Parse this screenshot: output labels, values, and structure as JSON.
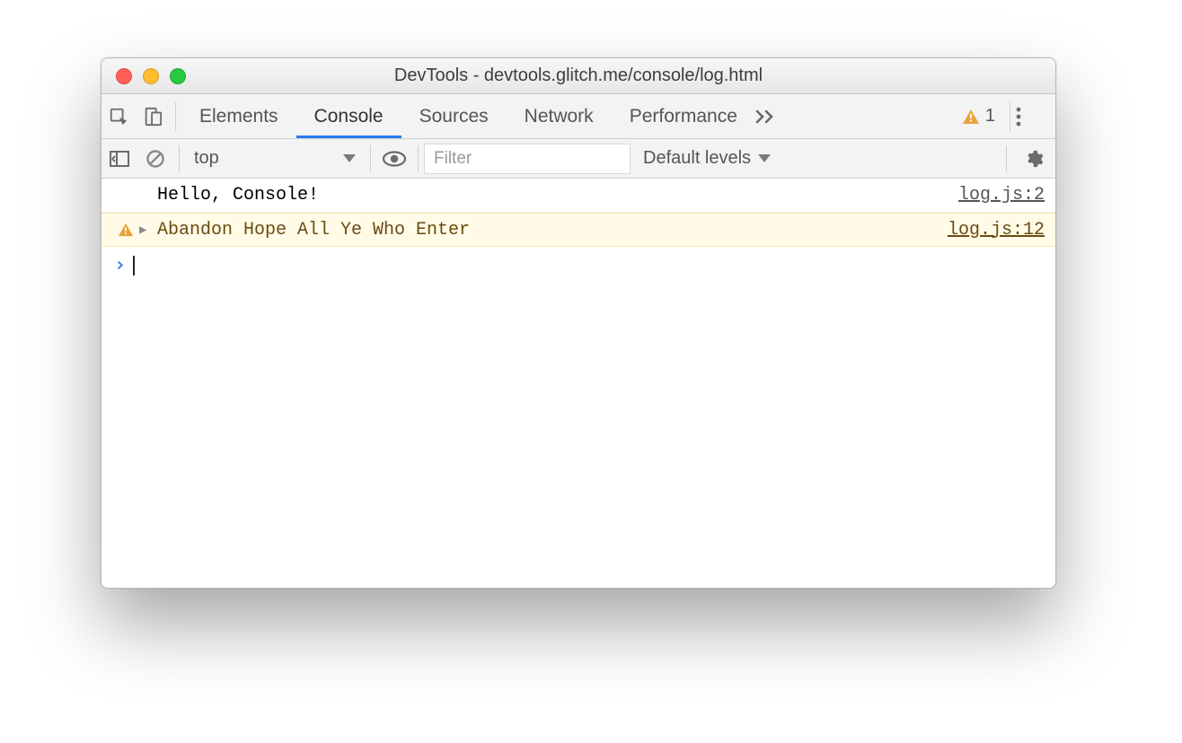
{
  "window": {
    "title": "DevTools - devtools.glitch.me/console/log.html"
  },
  "tabs": {
    "items": [
      "Elements",
      "Console",
      "Sources",
      "Network",
      "Performance"
    ],
    "active_index": 1,
    "warning_count": "1"
  },
  "toolbar": {
    "context": "top",
    "filter_placeholder": "Filter",
    "levels_label": "Default levels"
  },
  "messages": [
    {
      "type": "log",
      "text": "Hello, Console!",
      "source": "log.js:2"
    },
    {
      "type": "warn",
      "text": "Abandon Hope All Ye Who Enter",
      "source": "log.js:12"
    }
  ]
}
